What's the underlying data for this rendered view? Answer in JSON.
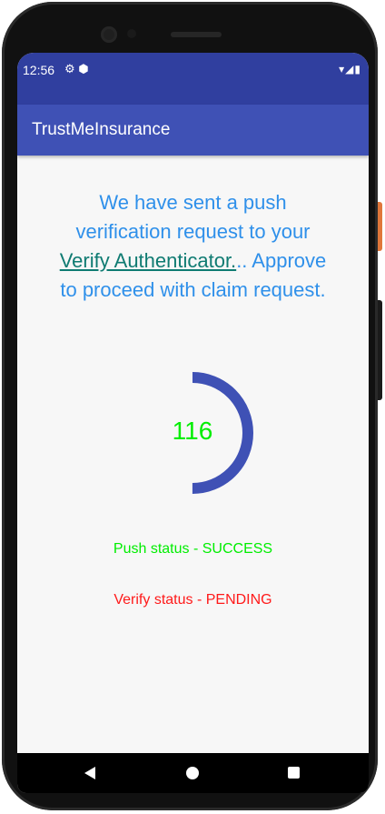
{
  "status_bar": {
    "time": "12:56",
    "left_icons": "⚙ ⬢",
    "right_icons": "▾◢▮"
  },
  "app_bar": {
    "title": "TrustMeInsurance"
  },
  "message": {
    "line_1": "We have sent a push",
    "line_2": "verification request to your",
    "link_text": "Verify Authenticator.",
    "after_link": ".. Approve",
    "line_4": "to proceed with claim request."
  },
  "timer": {
    "value": "116",
    "progress_fraction": 0.5
  },
  "status": {
    "push": "Push status - SUCCESS",
    "verify": "Verify status - PENDING"
  },
  "colors": {
    "status_bar": "#303f9f",
    "app_bar": "#3f51b5",
    "message_text": "#2f90ea",
    "link_text": "#0f7b72",
    "timer_arc": "#3f51b5",
    "success": "#00ee00",
    "pending": "#ff1a1a"
  },
  "icons": {
    "status_left": [
      "gear-icon",
      "data-saver-icon"
    ],
    "status_right": [
      "wifi-icon",
      "signal-icon",
      "battery-icon"
    ],
    "nav": [
      "back-icon",
      "home-icon",
      "recents-icon"
    ]
  }
}
